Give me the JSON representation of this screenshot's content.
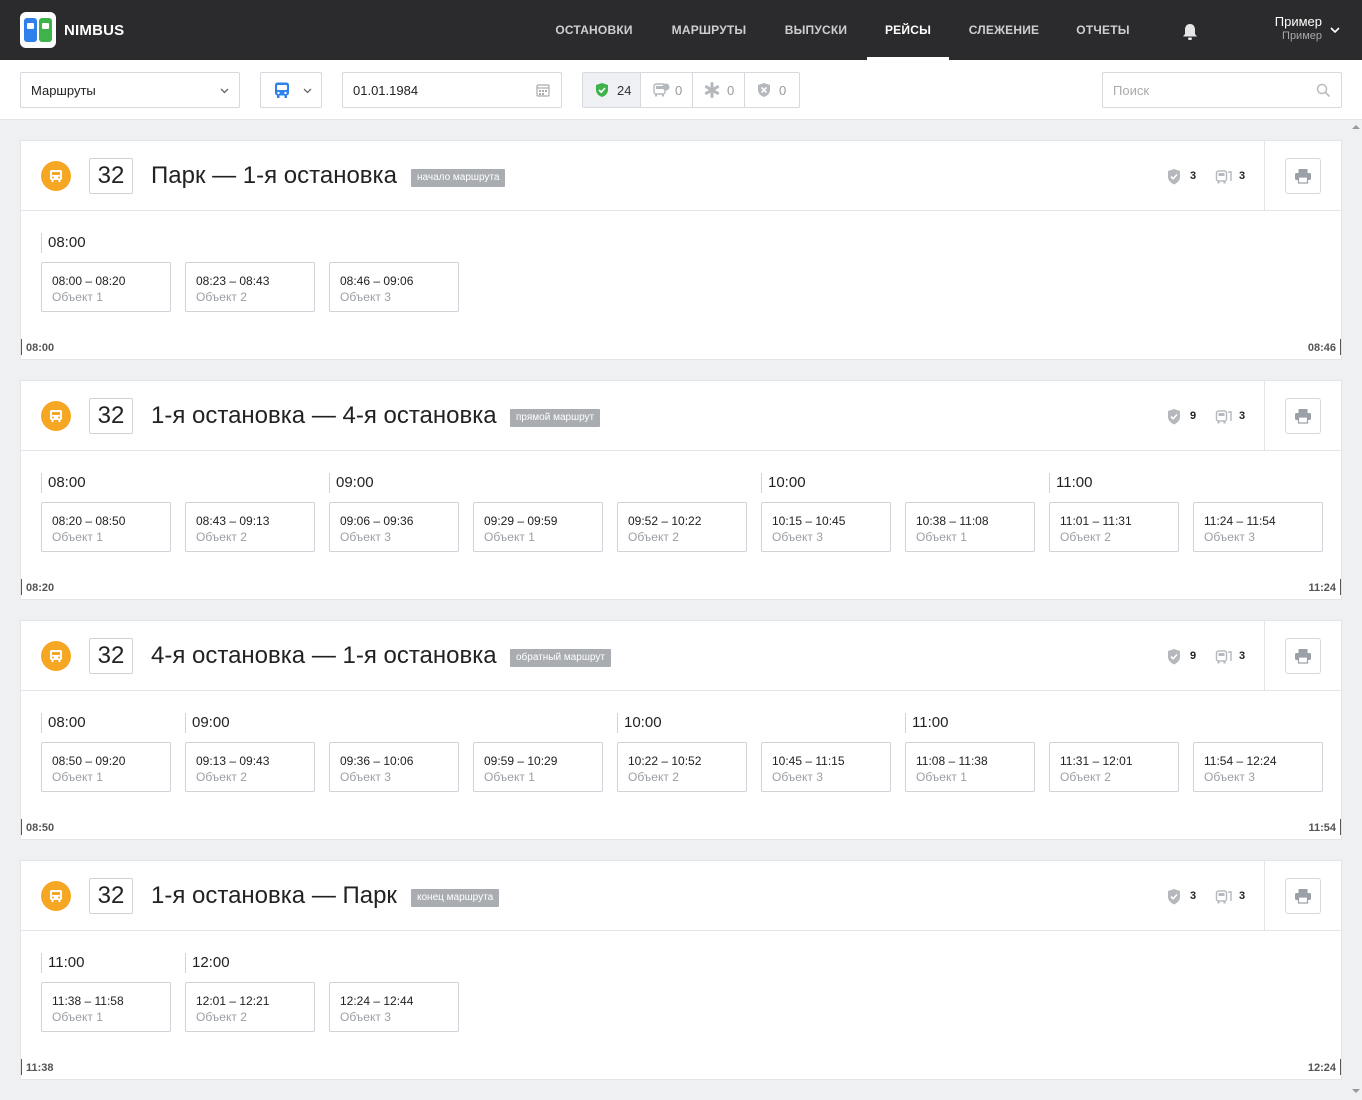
{
  "app": {
    "name": "NIMBUS"
  },
  "nav": {
    "items": [
      {
        "label": "ОСТАНОВКИ"
      },
      {
        "label": "МАРШРУТЫ"
      },
      {
        "label": "ВЫПУСКИ"
      },
      {
        "label": "РЕЙСЫ"
      },
      {
        "label": "СЛЕЖЕНИЕ"
      },
      {
        "label": "ОТЧЕТЫ"
      }
    ],
    "active": "РЕЙСЫ",
    "user": {
      "name": "Пример",
      "role": "Пример"
    }
  },
  "toolbar": {
    "routes_select": "Маршруты",
    "transport_icon": "bus-icon",
    "date": "01.01.1984",
    "status_filters": [
      {
        "icon": "shield-check-icon",
        "count": "24",
        "color": "#3fb24b"
      },
      {
        "icon": "bus-alert-icon",
        "count": "0"
      },
      {
        "icon": "asterisk-icon",
        "count": "0"
      },
      {
        "icon": "shield-x-icon",
        "count": "0"
      }
    ],
    "search_placeholder": "Поиск"
  },
  "colors": {
    "accent": "#f5a623",
    "nav_bg": "#2b2b2d",
    "badge_bg": "#a9adb2"
  },
  "routes": [
    {
      "number": "32",
      "title": "Парк — 1-я остановка",
      "badge": "начало маршрута",
      "done_count": "3",
      "bus_count": "3",
      "hours": [
        "08:00"
      ],
      "trips": [
        {
          "time": "08:00 – 08:20",
          "object": "Объект 1"
        },
        {
          "time": "08:23 – 08:43",
          "object": "Объект 2"
        },
        {
          "time": "08:46 – 09:06",
          "object": "Объект 3"
        }
      ],
      "timeline_start": "08:00",
      "timeline_end": "08:46"
    },
    {
      "number": "32",
      "title": "1-я остановка — 4-я остановка",
      "badge": "прямой маршрут",
      "done_count": "9",
      "bus_count": "3",
      "hours": [
        "08:00",
        "09:00",
        "10:00",
        "11:00"
      ],
      "trips": [
        {
          "time": "08:20 – 08:50",
          "object": "Объект 1"
        },
        {
          "time": "08:43 – 09:13",
          "object": "Объект 2"
        },
        {
          "time": "09:06 – 09:36",
          "object": "Объект 3"
        },
        {
          "time": "09:29 – 09:59",
          "object": "Объект 1"
        },
        {
          "time": "09:52 – 10:22",
          "object": "Объект 2"
        },
        {
          "time": "10:15 – 10:45",
          "object": "Объект 3"
        },
        {
          "time": "10:38 – 11:08",
          "object": "Объект 1"
        },
        {
          "time": "11:01 – 11:31",
          "object": "Объект 2"
        },
        {
          "time": "11:24 – 11:54",
          "object": "Объект 3"
        }
      ],
      "timeline_start": "08:20",
      "timeline_end": "11:24"
    },
    {
      "number": "32",
      "title": "4-я остановка — 1-я остановка",
      "badge": "обратный маршрут",
      "done_count": "9",
      "bus_count": "3",
      "hours": [
        "08:00",
        "09:00",
        "10:00",
        "11:00"
      ],
      "trips": [
        {
          "time": "08:50 – 09:20",
          "object": "Объект 1"
        },
        {
          "time": "09:13 – 09:43",
          "object": "Объект 2"
        },
        {
          "time": "09:36 – 10:06",
          "object": "Объект 3"
        },
        {
          "time": "09:59 – 10:29",
          "object": "Объект 1"
        },
        {
          "time": "10:22 – 10:52",
          "object": "Объект 2"
        },
        {
          "time": "10:45 – 11:15",
          "object": "Объект 3"
        },
        {
          "time": "11:08 – 11:38",
          "object": "Объект 1"
        },
        {
          "time": "11:31 – 12:01",
          "object": "Объект 2"
        },
        {
          "time": "11:54 – 12:24",
          "object": "Объект 3"
        }
      ],
      "timeline_start": "08:50",
      "timeline_end": "11:54"
    },
    {
      "number": "32",
      "title": "1-я остановка — Парк",
      "badge": "конец маршрута",
      "done_count": "3",
      "bus_count": "3",
      "hours": [
        "11:00",
        "12:00"
      ],
      "trips": [
        {
          "time": "11:38 – 11:58",
          "object": "Объект 1"
        },
        {
          "time": "12:01 – 12:21",
          "object": "Объект 2"
        },
        {
          "time": "12:24 – 12:44",
          "object": "Объект 3"
        }
      ],
      "timeline_start": "11:38",
      "timeline_end": "12:24"
    }
  ]
}
